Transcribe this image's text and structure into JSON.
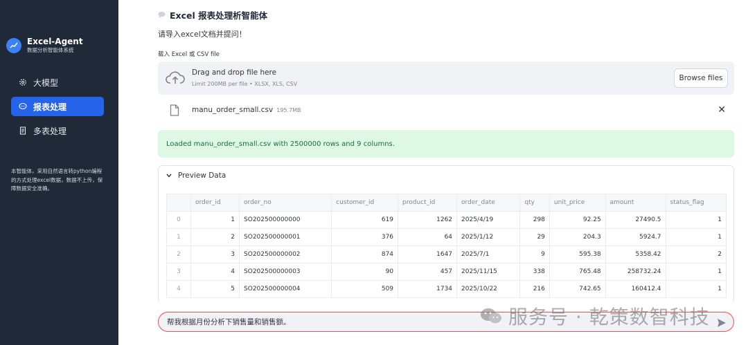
{
  "sidebar": {
    "brand_title": "Excel-Agent",
    "brand_subtitle": "数据分析智能体系统",
    "items": [
      {
        "label": "大模型",
        "icon": "gear-icon",
        "active": false
      },
      {
        "label": "报表处理",
        "icon": "chat-icon",
        "active": true
      },
      {
        "label": "多表处理",
        "icon": "document-icon",
        "active": false
      }
    ],
    "description": "本智能体，采用自然语言转python编程的方式处理excel数据，数据不上传，保障数据安全准确。"
  },
  "main": {
    "title": "Excel 报表处理析智能体",
    "prompt": "请导入excel文档并提问！",
    "upload_label": "载入 Excel 或 CSV file",
    "dropzone": {
      "main_text": "Drag and drop file here",
      "sub_text": "Limit 200MB per file • XLSX, XLS, CSV",
      "browse_label": "Browse files"
    },
    "file": {
      "name": "manu_order_small.csv",
      "size": "195.7MB",
      "close": "✕"
    },
    "alert": "Loaded manu_order_small.csv with 2500000 rows and 9 columns.",
    "preview": {
      "label": "Preview Data",
      "columns": [
        "",
        "order_id",
        "order_no",
        "customer_id",
        "product_id",
        "order_date",
        "qty",
        "unit_price",
        "amount",
        "status_flag"
      ],
      "rows": [
        [
          "0",
          "1",
          "SO202500000000",
          "619",
          "1262",
          "2025/4/19",
          "298",
          "92.25",
          "27490.5",
          "1"
        ],
        [
          "1",
          "2",
          "SO202500000001",
          "376",
          "64",
          "2025/1/12",
          "29",
          "204.3",
          "5924.7",
          "1"
        ],
        [
          "2",
          "3",
          "SO202500000002",
          "874",
          "1647",
          "2025/7/1",
          "9",
          "595.38",
          "5358.42",
          "2"
        ],
        [
          "3",
          "4",
          "SO202500000003",
          "90",
          "457",
          "2025/11/15",
          "338",
          "765.48",
          "258732.24",
          "1"
        ],
        [
          "4",
          "5",
          "SO202500000004",
          "509",
          "1734",
          "2025/10/22",
          "216",
          "742.65",
          "160412.4",
          "1"
        ]
      ]
    },
    "chat": {
      "value": "帮我根据月份分析下销售量和销售额。"
    }
  },
  "watermark": "服务号 · 乾策数智科技",
  "colors": {
    "sidebar_bg": "#1f2937",
    "accent": "#2563eb",
    "success_bg": "#dff7e5",
    "success_text": "#177233",
    "chat_border": "#ff4b4b"
  }
}
